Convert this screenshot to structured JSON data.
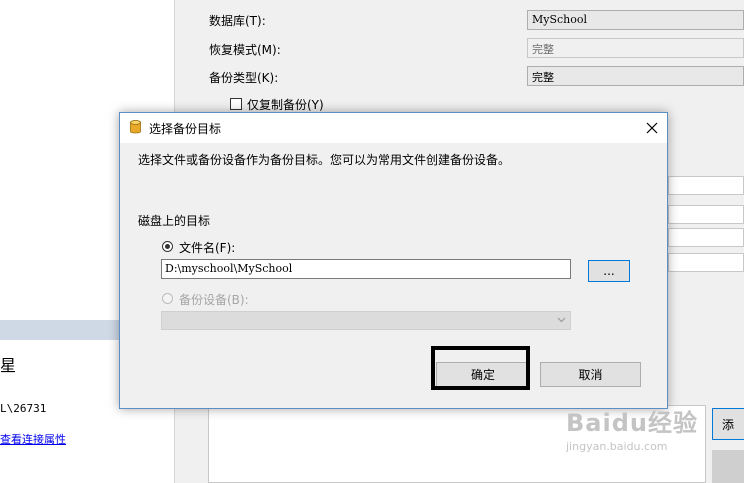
{
  "left_panel": {
    "char": "星",
    "path_text": "L\\26731",
    "link_text": "查看连接属性"
  },
  "form": {
    "database_label": "数据库(T):",
    "database_value": "MySchool",
    "recovery_label": "恢复模式(M):",
    "recovery_value": "完整",
    "backup_type_label": "备份类型(K):",
    "backup_type_value": "完整",
    "copy_only_label": "仅复制备份(Y)",
    "add_button_partial": "添"
  },
  "dialog": {
    "title": "选择备份目标",
    "description": "选择文件或备份设备作为备份目标。您可以为常用文件创建备份设备。",
    "section_title": "磁盘上的目标",
    "file_name_label": "文件名(F):",
    "file_path": "D:\\myschool\\MySchool",
    "browse_label": "...",
    "backup_device_label": "备份设备(B):",
    "backup_device_value": "",
    "ok_label": "确定",
    "cancel_label": "取消"
  },
  "watermark": {
    "line1": "Baidu经验",
    "line2": "jingyan.baidu.com"
  },
  "colors": {
    "dialog_border": "#5b8fc7",
    "selection_band": "#cfd9e6",
    "link": "#0000ee",
    "focus_border": "#0078d7"
  }
}
